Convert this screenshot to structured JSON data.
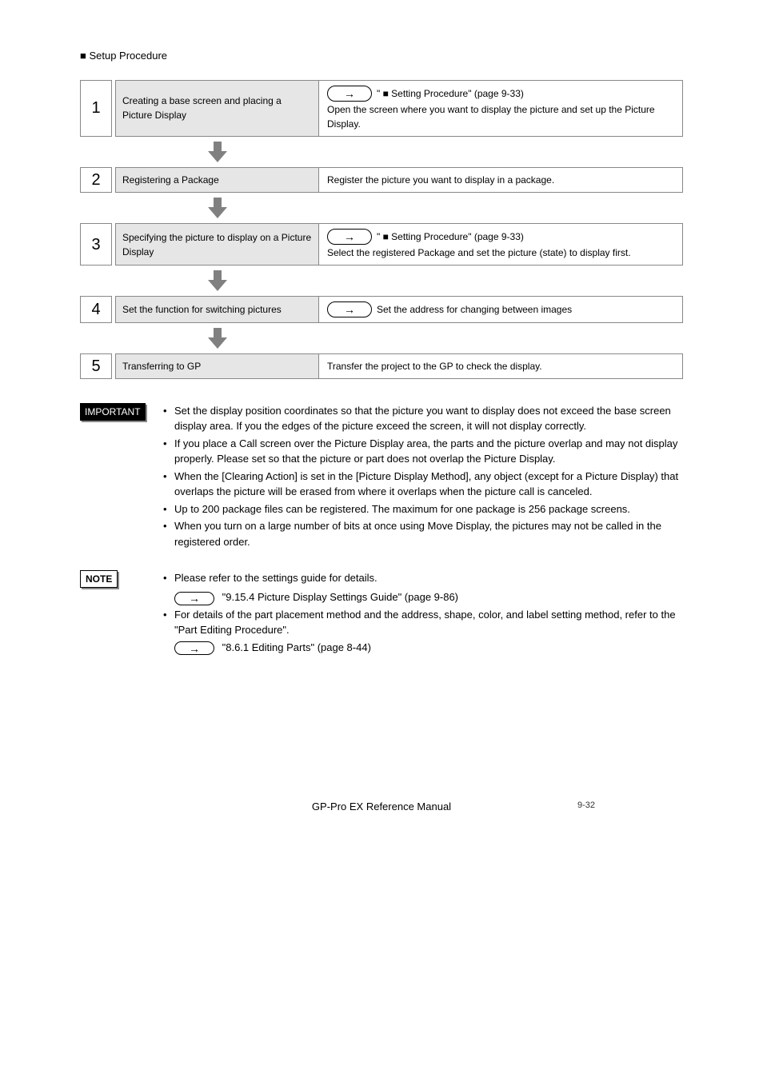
{
  "section_title": "■ Setup Procedure",
  "steps": [
    {
      "num": "1",
      "label": "Creating a base screen and placing a Picture Display",
      "desc_prefix_capsule": true,
      "desc": "\" ■ Setting Procedure\" (page 9-33)\nOpen the screen where you want to display the picture and set up the Picture Display."
    },
    {
      "num": "2",
      "label": "Registering a Package",
      "desc_prefix_capsule": false,
      "desc": "Register the picture you want to display in a package."
    },
    {
      "num": "3",
      "label": "Specifying the picture to display on a Picture Display",
      "desc_prefix_capsule": true,
      "desc": "\" ■ Setting Procedure\" (page 9-33)\nSelect the registered Package and set the picture (state) to display first."
    },
    {
      "num": "4",
      "label": "Set the function for switching pictures",
      "desc_prefix_capsule": true,
      "desc": "Set the address for changing between images"
    },
    {
      "num": "5",
      "label": "Transferring to GP",
      "desc_prefix_capsule": false,
      "desc": "Transfer the project to the GP to check the display."
    }
  ],
  "important": {
    "label": "IMPORTANT",
    "bullets": [
      "Set the display position coordinates so that the picture you want to display does not exceed the base screen display area. If you the edges of the picture exceed the screen, it will not display correctly.",
      "If you place a Call screen over the Picture Display area, the parts and the picture overlap and may not display properly. Please set so that the picture or part does not overlap the Picture Display.",
      "When the [Clearing Action] is set in the [Picture Display Method], any object (except for a Picture Display) that overlaps the picture will be erased from where it overlaps when the picture call is canceled.",
      "Up to 200 package files can be registered. The maximum for one package is 256 package screens.",
      "When you turn on a large number of bits at once using Move Display, the pictures may not be called in the registered order."
    ]
  },
  "note": {
    "label": "NOTE",
    "bullets": [
      "Please refer to the settings guide for details.",
      "For details of the part placement method and the address, shape, color, and label setting method, refer to the \"Part Editing Procedure\"."
    ],
    "refs": [
      "\"9.15.4 Picture Display Settings Guide\" (page 9-86)",
      "\"8.6.1 Editing Parts\" (page 8-44)"
    ]
  },
  "footer": {
    "center": "GP-Pro EX Reference Manual",
    "right": "9-32"
  }
}
